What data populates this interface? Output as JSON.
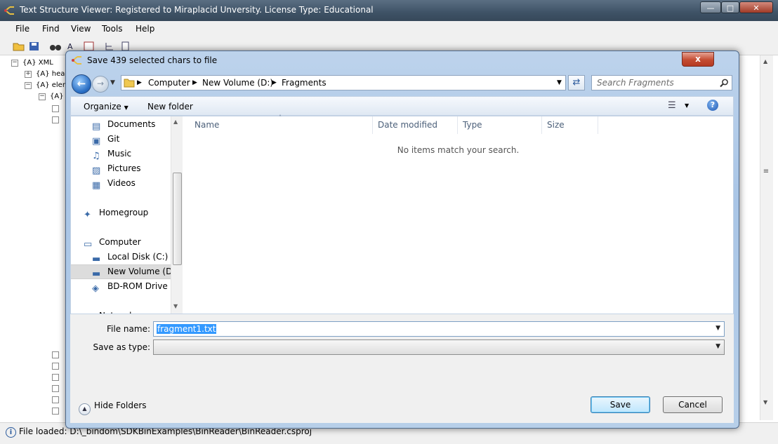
{
  "main_window": {
    "title": "Text Structure Viewer: Registered to Miraplacid Unversity. License Type: Educational",
    "menu": [
      "File",
      "Find",
      "View",
      "Tools",
      "Help"
    ],
    "tree": [
      {
        "label": "{A} XML",
        "indent": 0,
        "sign": "−"
      },
      {
        "label": "{A} head",
        "indent": 1,
        "sign": "+"
      },
      {
        "label": "{A} elem",
        "indent": 1,
        "sign": "−"
      },
      {
        "label": "{A} t",
        "indent": 2,
        "sign": "−"
      }
    ],
    "status_text": "File loaded: D:\\_bindom\\SDKBinExamples\\BinReader\\BinReader.csproj"
  },
  "dialog": {
    "title": "Save 439 selected chars to file",
    "close_label": "x",
    "breadcrumb": [
      "Computer",
      "New Volume (D:)",
      "Fragments"
    ],
    "search_placeholder": "Search Fragments",
    "organize_label": "Organize",
    "new_folder_label": "New folder",
    "nav_items": [
      {
        "label": "Documents",
        "icon": "documents-icon",
        "indent": 1
      },
      {
        "label": "Git",
        "icon": "git-library-icon",
        "indent": 1
      },
      {
        "label": "Music",
        "icon": "music-icon",
        "indent": 1
      },
      {
        "label": "Pictures",
        "icon": "pictures-icon",
        "indent": 1
      },
      {
        "label": "Videos",
        "icon": "videos-icon",
        "indent": 1
      },
      {
        "label": "",
        "icon": "",
        "indent": 0
      },
      {
        "label": "Homegroup",
        "icon": "homegroup-icon",
        "indent": 0
      },
      {
        "label": "",
        "icon": "",
        "indent": 0
      },
      {
        "label": "Computer",
        "icon": "computer-icon",
        "indent": 0
      },
      {
        "label": "Local Disk (C:)",
        "icon": "disk-icon",
        "indent": 1
      },
      {
        "label": "New Volume (D:)",
        "icon": "drive-icon",
        "indent": 1,
        "selected": true
      },
      {
        "label": "BD-ROM Drive (F",
        "icon": "bdrom-icon",
        "indent": 1
      },
      {
        "label": "",
        "icon": "",
        "indent": 0
      },
      {
        "label": "Network",
        "icon": "network-icon",
        "indent": 0
      }
    ],
    "columns": [
      "Name",
      "Date modified",
      "Type",
      "Size"
    ],
    "empty_message": "No items match your search.",
    "file_name_label": "File name:",
    "file_name_value": "fragment1.txt",
    "save_type_label": "Save as type:",
    "save_type_value": "",
    "hide_folders_label": "Hide Folders",
    "save_label": "Save",
    "cancel_label": "Cancel"
  }
}
